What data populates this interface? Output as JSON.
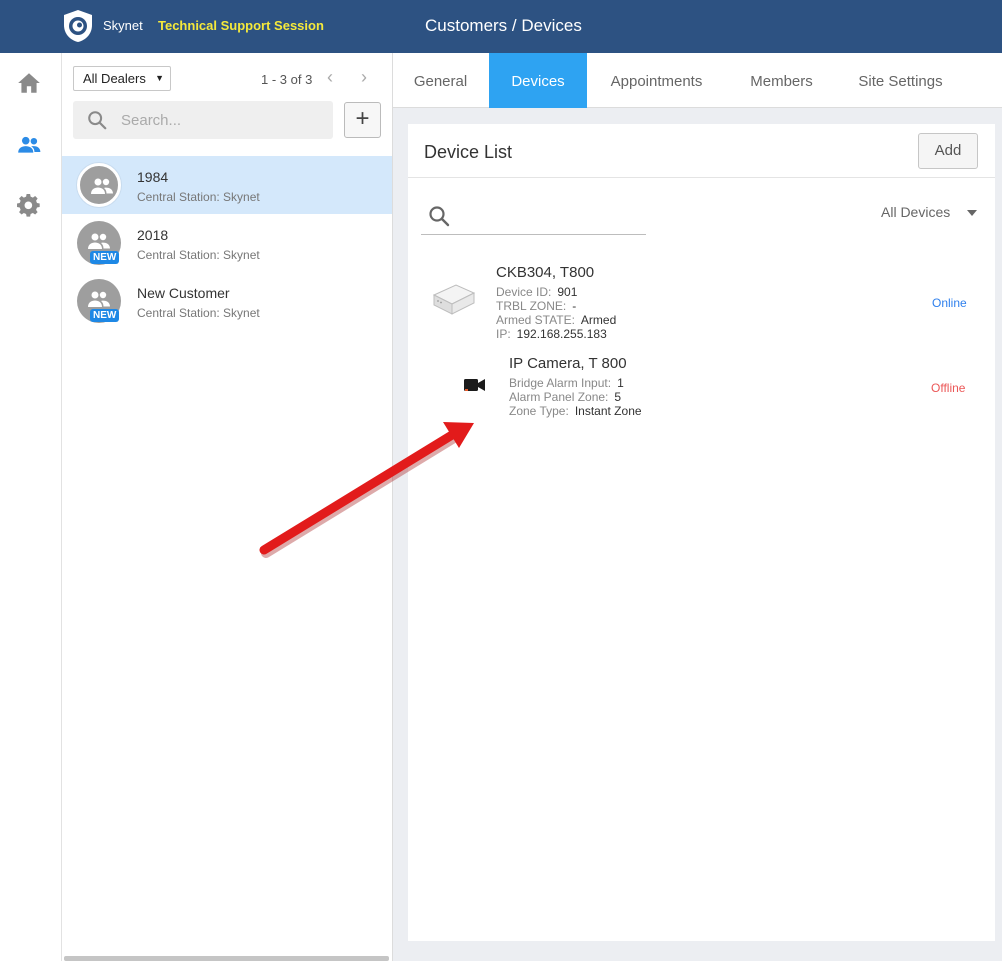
{
  "header": {
    "brand": "Skynet",
    "session_label": "Technical Support Session",
    "page_title": "Customers / Devices"
  },
  "nav": {
    "icons": [
      "home-icon",
      "customers-icon",
      "settings-icon"
    ],
    "active": "customers-icon"
  },
  "list": {
    "dealer_filter": "All Dealers",
    "pagination": "1 - 3 of 3",
    "search_placeholder": "Search...",
    "customers": [
      {
        "name": "1984",
        "station": "Central Station: Skynet",
        "badge": "",
        "selected": true
      },
      {
        "name": "2018",
        "station": "Central Station: Skynet",
        "badge": "NEW",
        "selected": false
      },
      {
        "name": "New Customer",
        "station": "Central Station: Skynet",
        "badge": "NEW",
        "selected": false
      }
    ]
  },
  "tabs": [
    {
      "label": "General"
    },
    {
      "label": "Devices",
      "active": true
    },
    {
      "label": "Appointments"
    },
    {
      "label": "Members"
    },
    {
      "label": "Site Settings"
    }
  ],
  "devices_panel": {
    "title": "Device List",
    "add_label": "Add",
    "filter_label": "All Devices",
    "devices": [
      {
        "name": "CKB304, T800",
        "icon": "router-device-icon",
        "fields": [
          {
            "label": "Device ID:",
            "value": "901"
          },
          {
            "label": "TRBL ZONE:",
            "value": "-"
          },
          {
            "label": "Armed STATE:",
            "value": "Armed"
          },
          {
            "label": "IP:",
            "value": "192.168.255.183"
          }
        ],
        "status": "Online"
      },
      {
        "name": "IP Camera, T 800",
        "icon": "camera-icon",
        "fields": [
          {
            "label": "Bridge Alarm Input:",
            "value": "1"
          },
          {
            "label": "Alarm Panel Zone:",
            "value": "5"
          },
          {
            "label": "Zone Type:",
            "value": "Instant Zone"
          }
        ],
        "status": "Offline"
      }
    ]
  },
  "colors": {
    "header": "#2d5282",
    "session_label": "#f5e93b",
    "active_tab": "#2ea3f2",
    "selected_row": "#d4e8fb",
    "online": "#2f80ed",
    "offline": "#eb5757",
    "annotation_arrow": "#e21b1b"
  }
}
